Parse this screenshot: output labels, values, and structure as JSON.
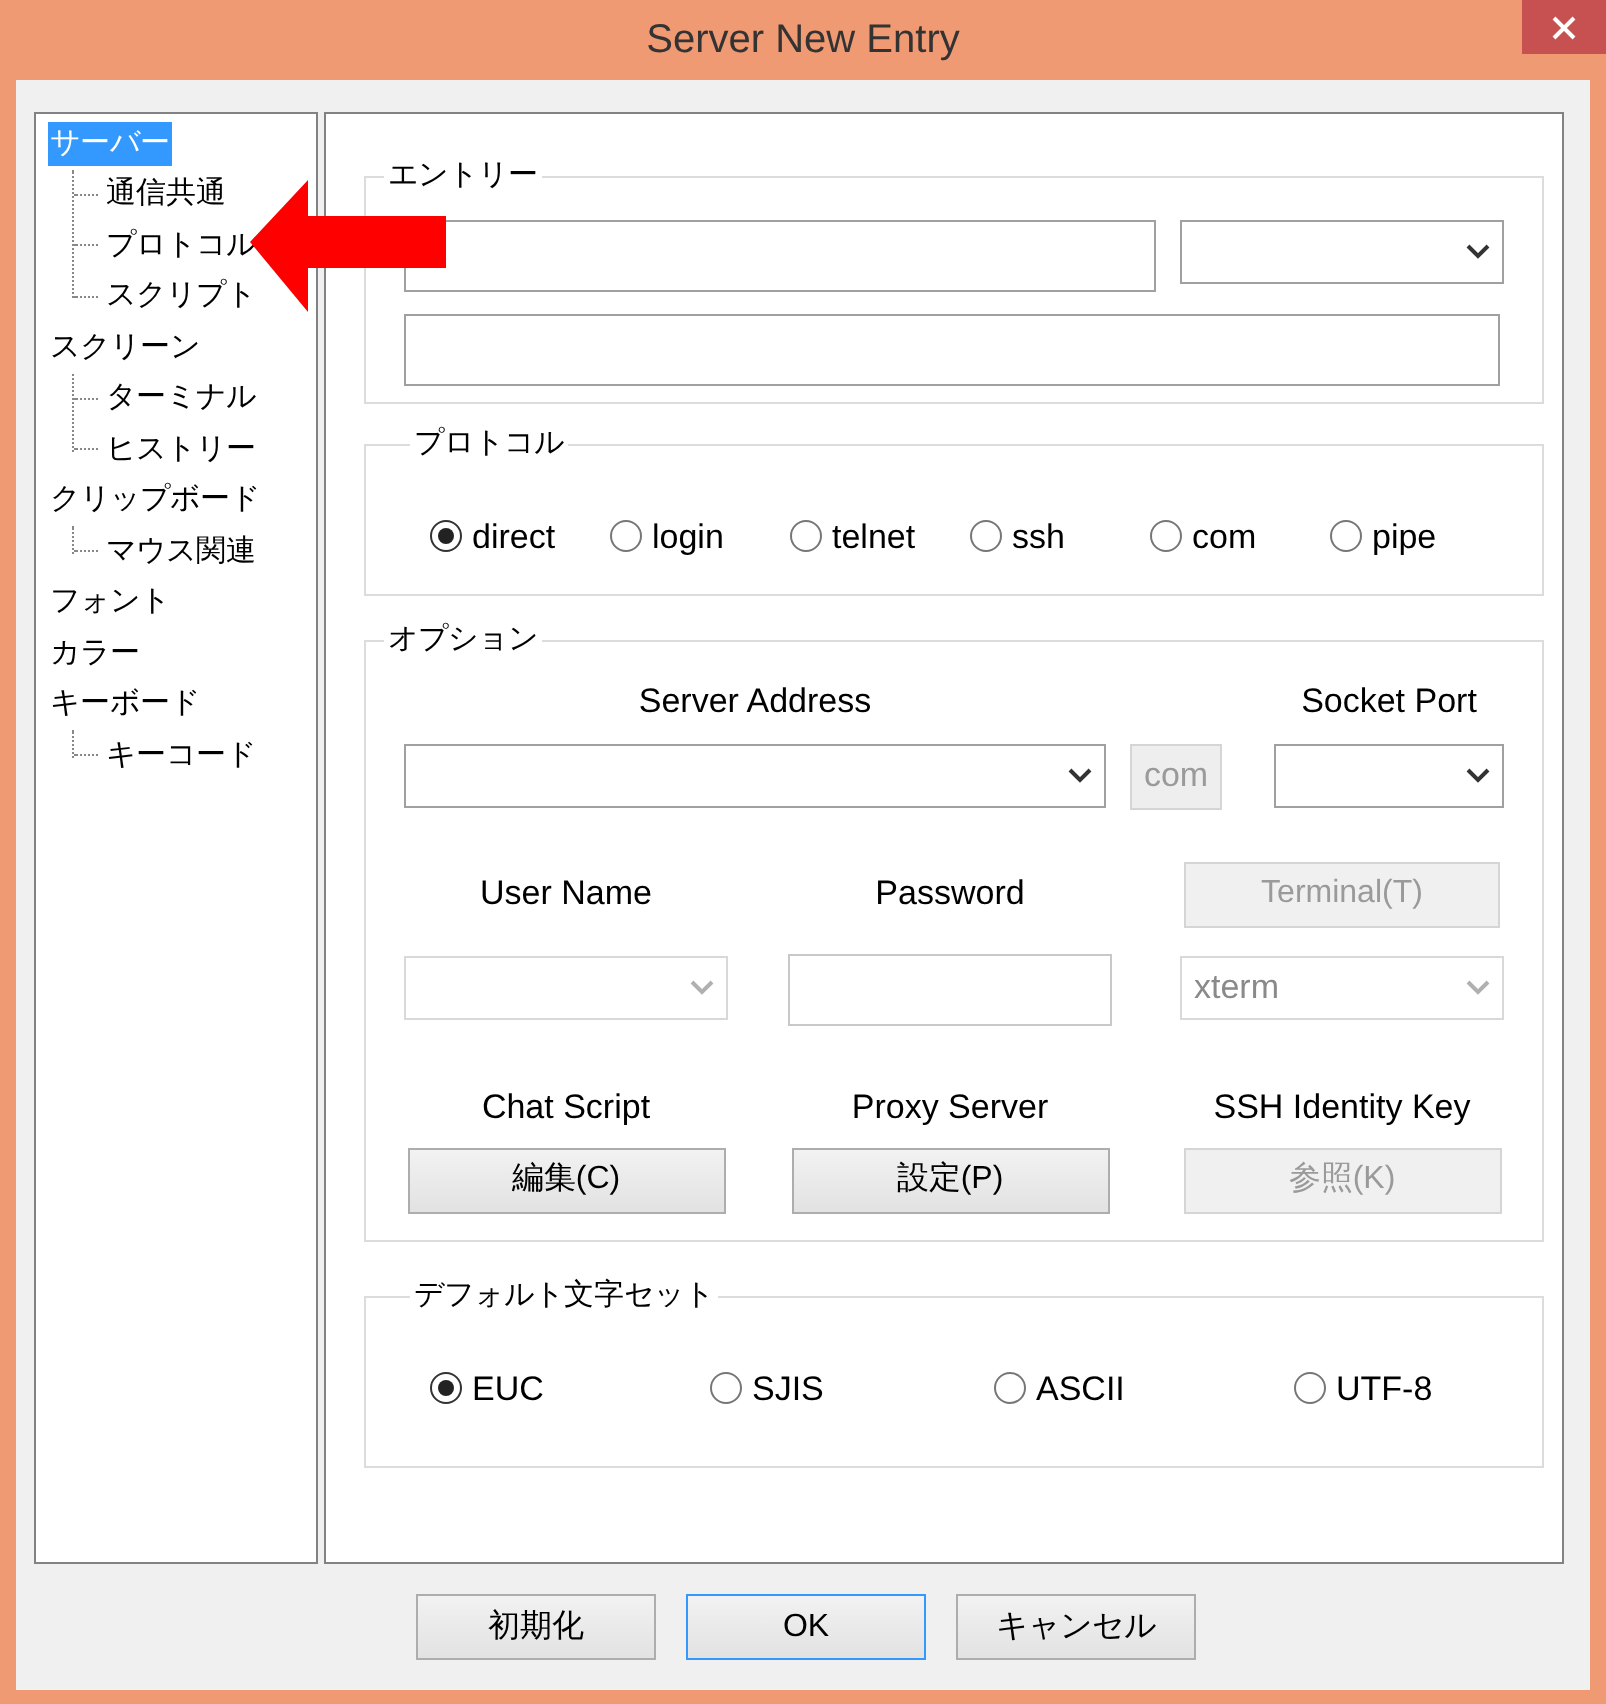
{
  "window": {
    "title": "Server New Entry"
  },
  "tree": [
    {
      "label": "サーバー",
      "selected": true,
      "children": [
        {
          "label": "通信共通",
          "selected": false
        },
        {
          "label": "プロトコル",
          "selected": false
        },
        {
          "label": "スクリプト",
          "selected": false
        }
      ]
    },
    {
      "label": "スクリーン",
      "selected": false,
      "children": [
        {
          "label": "ターミナル",
          "selected": false
        },
        {
          "label": "ヒストリー",
          "selected": false
        }
      ]
    },
    {
      "label": "クリップボード",
      "selected": false,
      "children": [
        {
          "label": "マウス関連",
          "selected": false
        }
      ]
    },
    {
      "label": "フォント",
      "selected": false
    },
    {
      "label": "カラー",
      "selected": false
    },
    {
      "label": "キーボード",
      "selected": false,
      "children": [
        {
          "label": "キーコード",
          "selected": false
        }
      ]
    }
  ],
  "entry": {
    "legend": "エントリー"
  },
  "protocol": {
    "legend": "プロトコル",
    "options": [
      {
        "label": "direct",
        "selected": true
      },
      {
        "label": "login",
        "selected": false
      },
      {
        "label": "telnet",
        "selected": false
      },
      {
        "label": "ssh",
        "selected": false
      },
      {
        "label": "com",
        "selected": false
      },
      {
        "label": "pipe",
        "selected": false
      }
    ]
  },
  "options": {
    "legend": "オプション",
    "server_address": {
      "label": "Server Address"
    },
    "com_button": {
      "label": "com",
      "disabled": true
    },
    "socket_port": {
      "label": "Socket Port"
    },
    "user_name": {
      "label": "User Name",
      "disabled": true
    },
    "password": {
      "label": "Password"
    },
    "terminal_button": {
      "label": "Terminal(T)",
      "disabled": true
    },
    "terminal_type": {
      "value": "xterm",
      "disabled": true
    },
    "chat_script": {
      "label": "Chat Script",
      "button": {
        "label": "編集(C)",
        "disabled": false
      }
    },
    "proxy_server": {
      "label": "Proxy Server",
      "button": {
        "label": "設定(P)",
        "disabled": false
      }
    },
    "ssh_identity_key": {
      "label": "SSH Identity Key",
      "button": {
        "label": "参照(K)",
        "disabled": true
      }
    }
  },
  "charset": {
    "legend": "デフォルト文字セット",
    "options": [
      {
        "label": "EUC",
        "selected": true
      },
      {
        "label": "SJIS",
        "selected": false
      },
      {
        "label": "ASCII",
        "selected": false
      },
      {
        "label": "UTF-8",
        "selected": false
      }
    ]
  },
  "buttons": [
    {
      "label": "初期化",
      "default": false
    },
    {
      "label": "OK",
      "default": true
    },
    {
      "label": "キャンセル",
      "default": false
    }
  ]
}
